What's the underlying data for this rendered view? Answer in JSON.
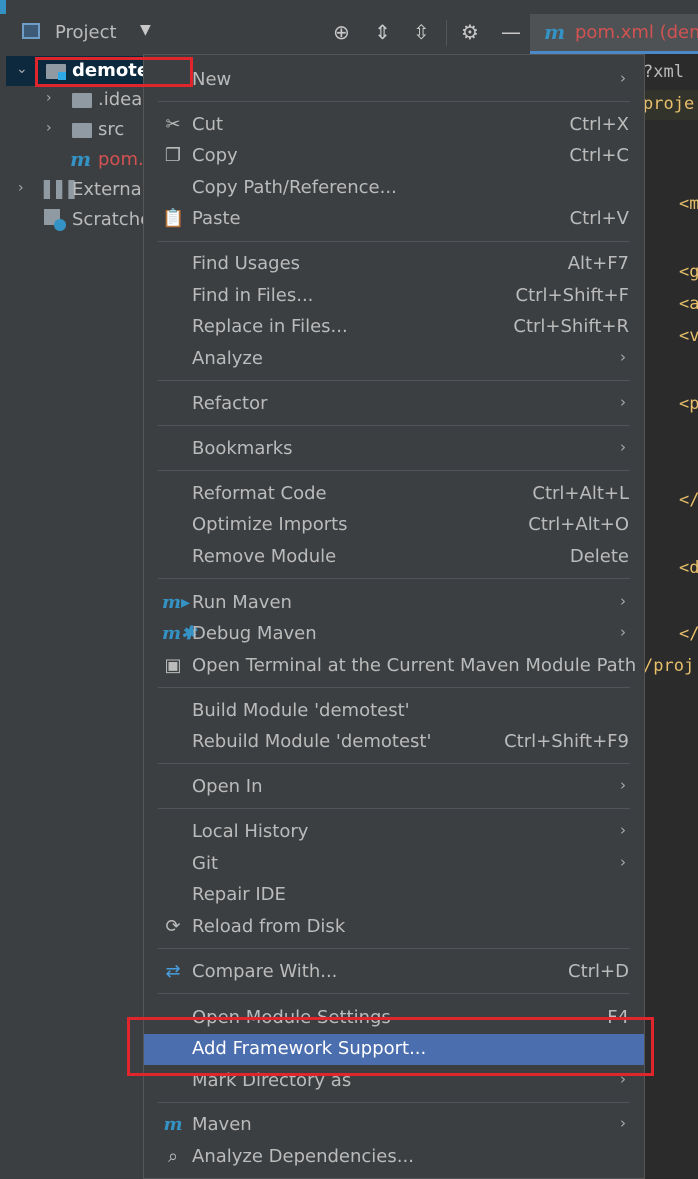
{
  "header": {
    "project_title": "Project",
    "icons": [
      "locate-icon",
      "expand-all-icon",
      "collapse-all-icon",
      "settings-icon",
      "hide-icon"
    ]
  },
  "editor_tab": {
    "icon_letter": "m",
    "label": "pom.xml (dem"
  },
  "tree": {
    "root_label": "demote",
    "idea_label": ".idea",
    "src_label": "src",
    "pom_label": "pom.",
    "external_label": "External",
    "scratches_label": "Scratche"
  },
  "code_lines": [
    "?xml",
    "proje",
    "<m",
    "<g",
    "<a",
    "<v",
    "<p",
    "</",
    "<d",
    "</",
    "/proj"
  ],
  "menu": {
    "new": "New",
    "cut": "Cut",
    "cut_sc": "Ctrl+X",
    "copy": "Copy",
    "copy_sc": "Ctrl+C",
    "copy_path": "Copy Path/Reference...",
    "paste": "Paste",
    "paste_sc": "Ctrl+V",
    "find_usages": "Find Usages",
    "find_usages_sc": "Alt+F7",
    "find_in_files": "Find in Files...",
    "find_in_files_sc": "Ctrl+Shift+F",
    "replace_in_files": "Replace in Files...",
    "replace_in_files_sc": "Ctrl+Shift+R",
    "analyze": "Analyze",
    "refactor": "Refactor",
    "bookmarks": "Bookmarks",
    "reformat": "Reformat Code",
    "reformat_sc": "Ctrl+Alt+L",
    "optimize": "Optimize Imports",
    "optimize_sc": "Ctrl+Alt+O",
    "remove_module": "Remove Module",
    "remove_module_sc": "Delete",
    "run_maven": "Run Maven",
    "debug_maven": "Debug Maven",
    "open_terminal": "Open Terminal at the Current Maven Module Path",
    "build_module": "Build Module 'demotest'",
    "rebuild_module": "Rebuild Module 'demotest'",
    "rebuild_module_sc": "Ctrl+Shift+F9",
    "open_in": "Open In",
    "local_history": "Local History",
    "git": "Git",
    "repair_ide": "Repair IDE",
    "reload": "Reload from Disk",
    "compare": "Compare With...",
    "compare_sc": "Ctrl+D",
    "module_settings": "Open Module Settings",
    "module_settings_sc": "F4",
    "add_framework": "Add Framework Support...",
    "mark_directory": "Mark Directory as",
    "maven": "Maven",
    "analyze_deps": "Analyze Dependencies..."
  },
  "colors": {
    "highlight": "#4b6eaf",
    "annotation_red": "#e0252d",
    "maven_blue": "#3592c4",
    "xml_tag": "#e8bf6a"
  }
}
